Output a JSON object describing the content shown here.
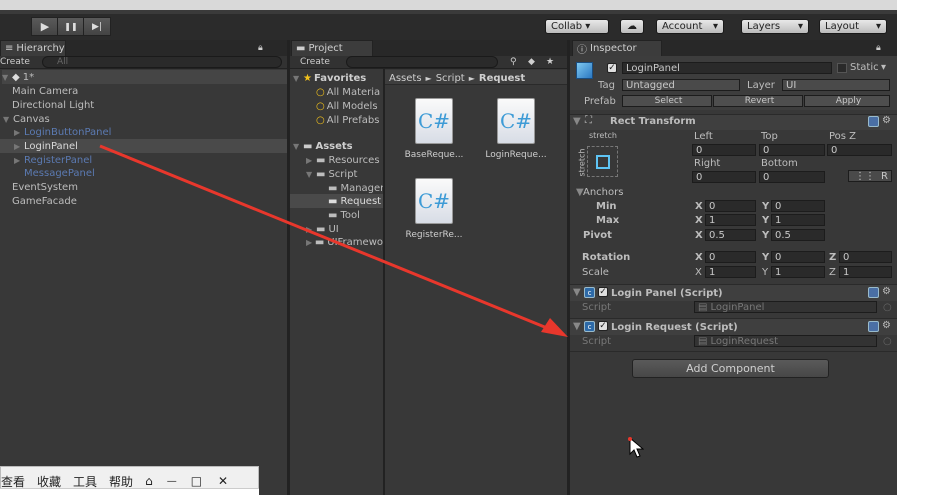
{
  "toolbar": {
    "play": "▶",
    "pause": "❚❚",
    "step": "▶|",
    "collab": "Collab ▾",
    "account": "Account",
    "layers": "Layers",
    "layout": "Layout",
    "cloud": "☁"
  },
  "hierarchy": {
    "tab": "Hierarchy",
    "create": "Create",
    "search": "All",
    "scene": "1*",
    "items": [
      {
        "label": "Main Camera"
      },
      {
        "label": "Directional Light"
      },
      {
        "label": "Canvas"
      },
      {
        "label": "LoginButtonPanel"
      },
      {
        "label": "LoginPanel"
      },
      {
        "label": "RegisterPanel"
      },
      {
        "label": "MessagePanel"
      },
      {
        "label": "EventSystem"
      },
      {
        "label": "GameFacade"
      }
    ]
  },
  "project": {
    "tab": "Project",
    "create": "Create",
    "favorites": "Favorites",
    "fav_items": [
      "All Materia",
      "All Models",
      "All Prefabs"
    ],
    "assets": "Assets",
    "tree": [
      "Resources",
      "Script",
      "Manager",
      "Request",
      "Tool",
      "UI",
      "UIFramewo"
    ],
    "breadcrumb": [
      "Assets",
      "Script",
      "Request"
    ],
    "files": [
      "BaseReque...",
      "LoginReque...",
      "RegisterRe..."
    ]
  },
  "inspector": {
    "tab": "Inspector",
    "name": "LoginPanel",
    "static": "Static",
    "tag_label": "Tag",
    "tag_value": "Untagged",
    "layer_label": "Layer",
    "layer_value": "UI",
    "prefab_label": "Prefab",
    "select": "Select",
    "revert": "Revert",
    "apply": "Apply",
    "rect": {
      "title": "Rect Transform",
      "stretch": "stretch",
      "stretch_v": "stretch",
      "left_l": "Left",
      "top_l": "Top",
      "posz_l": "Pos Z",
      "left": "0",
      "top": "0",
      "posz": "0",
      "right_l": "Right",
      "bottom_l": "Bottom",
      "right": "0",
      "bottom": "0",
      "r_btn": "R",
      "anchors": "Anchors",
      "min": "Min",
      "max": "Max",
      "pivot": "Pivot",
      "min_x": "0",
      "min_y": "0",
      "max_x": "1",
      "max_y": "1",
      "pivot_x": "0.5",
      "pivot_y": "0.5",
      "rotation": "Rotation",
      "scale": "Scale",
      "rot_x": "0",
      "rot_y": "0",
      "rot_z": "0",
      "scale_x": "1",
      "scale_y": "1",
      "scale_z": "1",
      "x": "X",
      "y": "Y",
      "z": "Z"
    },
    "comp1": {
      "title": "Login Panel (Script)",
      "script_l": "Script",
      "script_v": "LoginPanel"
    },
    "comp2": {
      "title": "Login Request (Script)",
      "script_l": "Script",
      "script_v": "LoginRequest"
    },
    "add_component": "Add Component"
  },
  "taskbar": {
    "items": [
      "查看",
      "收藏",
      "工具",
      "帮助"
    ],
    "shirt": "👕",
    "min": "—",
    "max": "□",
    "close": "✕"
  },
  "colors": {
    "bg": "#383838",
    "arrow": "#e8372c",
    "selected": "#4a4a4a"
  }
}
